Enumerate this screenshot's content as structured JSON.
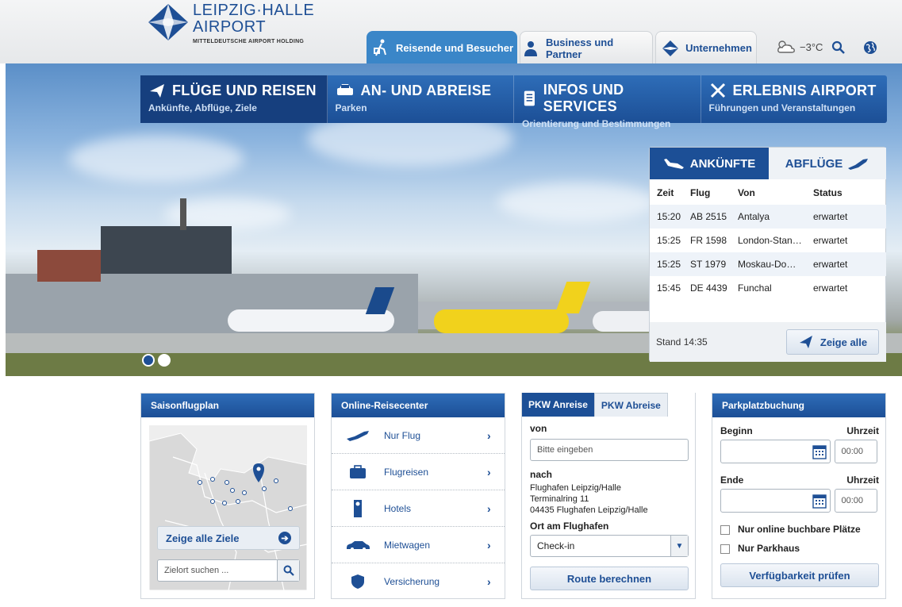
{
  "logo": {
    "line1": "LEIPZIG·HALLE",
    "line2": "AIRPORT",
    "sub": "MITTELDEUTSCHE AIRPORT HOLDING"
  },
  "tabs": [
    {
      "label": "Reisende und Besucher"
    },
    {
      "label": "Business und Partner"
    },
    {
      "label": "Unternehmen"
    }
  ],
  "weather": {
    "temp": "−3°C"
  },
  "nav": [
    {
      "title": "FLÜGE UND REISEN",
      "sub": "Ankünfte, Abflüge, Ziele"
    },
    {
      "title": "AN- UND ABREISE",
      "sub": "Parken"
    },
    {
      "title": "INFOS UND SERVICES",
      "sub": "Orientierung und Bestimmungen"
    },
    {
      "title": "ERLEBNIS AIRPORT",
      "sub": "Führungen und Veranstaltungen"
    }
  ],
  "flights": {
    "tab_arr": "ANKÜNFTE",
    "tab_dep": "ABFLÜGE",
    "headers": [
      "Zeit",
      "Flug",
      "Von",
      "Status"
    ],
    "rows": [
      [
        "15:20",
        "AB 2515",
        "Antalya",
        "erwartet"
      ],
      [
        "15:25",
        "FR 1598",
        "London-Stan…",
        "erwartet"
      ],
      [
        "15:25",
        "ST 1979",
        "Moskau-Do…",
        "erwartet"
      ],
      [
        "15:45",
        "DE 4439",
        "Funchal",
        "erwartet"
      ]
    ],
    "stand": "Stand 14:35",
    "show_all": "Zeige alle"
  },
  "season": {
    "title": "Saisonflugplan",
    "show_all": "Zeige alle Ziele",
    "search_placeholder": "Zielort suchen ..."
  },
  "online": {
    "title": "Online-Reisecenter",
    "items": [
      {
        "label": "Nur Flug"
      },
      {
        "label": "Flugreisen"
      },
      {
        "label": "Hotels"
      },
      {
        "label": "Mietwagen"
      },
      {
        "label": "Versicherung"
      }
    ]
  },
  "route": {
    "tab_on": "PKW Anreise",
    "tab_off": "PKW Abreise",
    "from": "von",
    "from_placeholder": "Bitte eingeben",
    "to": "nach",
    "addr1": "Flughafen Leipzig/Halle",
    "addr2": "Terminalring 11",
    "addr3": "04435 Flughafen Leipzig/Halle",
    "place_label": "Ort am Flughafen",
    "place_value": "Check-in",
    "button": "Route berechnen"
  },
  "parking": {
    "title": "Parkplatzbuchung",
    "begin": "Beginn",
    "end": "Ende",
    "time": "Uhrzeit",
    "time_value": "00:00",
    "opt1": "Nur online buchbare Plätze",
    "opt2": "Nur Parkhaus",
    "button": "Verfügbarkeit prüfen"
  }
}
